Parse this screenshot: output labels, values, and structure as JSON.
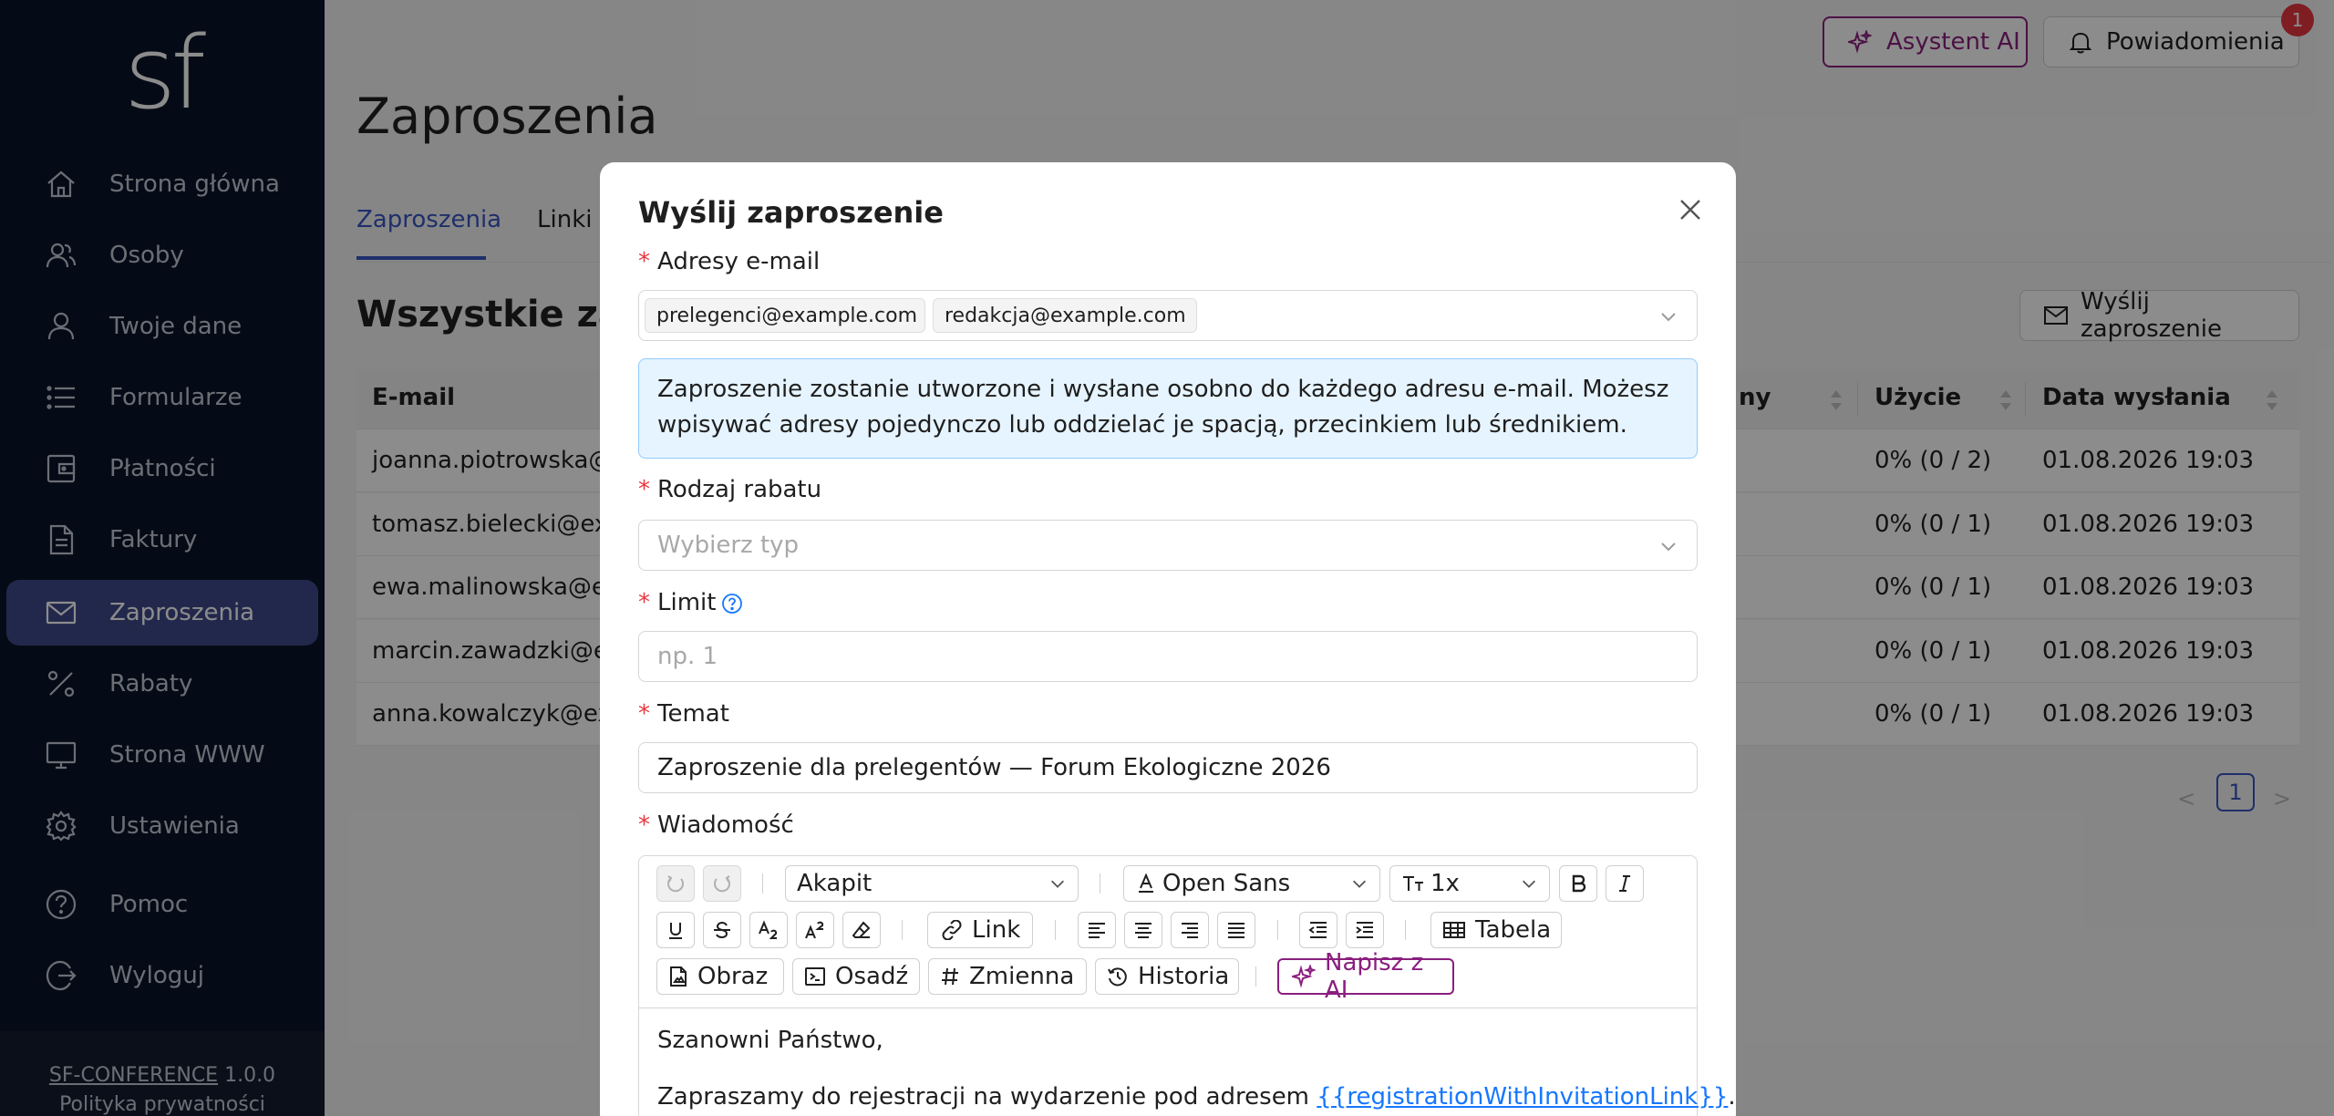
{
  "sidebar": {
    "logo": "sf",
    "items": [
      {
        "label": "Strona główna",
        "icon": "home-icon"
      },
      {
        "label": "Osoby",
        "icon": "users-icon"
      },
      {
        "label": "Twoje dane",
        "icon": "user-icon"
      },
      {
        "label": "Formularze",
        "icon": "list-icon"
      },
      {
        "label": "Płatności",
        "icon": "wallet-icon"
      },
      {
        "label": "Faktury",
        "icon": "document-icon"
      },
      {
        "label": "Zaproszenia",
        "icon": "mail-icon",
        "active": true
      },
      {
        "label": "Rabaty",
        "icon": "percent-icon"
      },
      {
        "label": "Strona WWW",
        "icon": "monitor-icon"
      },
      {
        "label": "Ustawienia",
        "icon": "gear-icon"
      },
      {
        "label": "Pomoc",
        "icon": "question-icon"
      },
      {
        "label": "Wyloguj",
        "icon": "logout-icon"
      }
    ],
    "footer": {
      "app_name": "SF-CONFERENCE",
      "version": "1.0.0",
      "privacy": "Polityka prywatności"
    }
  },
  "header": {
    "ai_button": "Asystent AI",
    "notifications_button": "Powiadomienia",
    "notifications_count": "1"
  },
  "page": {
    "title": "Zaproszenia",
    "tabs": [
      "Zaproszenia",
      "Linki r"
    ],
    "section_title": "Wszystkie zapro",
    "send_button": "Wyślij zaproszenie"
  },
  "table": {
    "columns": [
      "E-mail",
      "ny",
      "Użycie",
      "Data wysłania"
    ],
    "rows": [
      {
        "email": "joanna.piotrowska@e",
        "usage": "0% (0 / 2)",
        "date": "01.08.2026 19:03"
      },
      {
        "email": "tomasz.bielecki@exan",
        "usage": "0% (0 / 1)",
        "date": "01.08.2026 19:03"
      },
      {
        "email": "ewa.malinowska@exa",
        "usage": "0% (0 / 1)",
        "date": "01.08.2026 19:03"
      },
      {
        "email": "marcin.zawadzki@exa",
        "usage": "0% (0 / 1)",
        "date": "01.08.2026 19:03"
      },
      {
        "email": "anna.kowalczyk@exar",
        "usage": "0% (0 / 1)",
        "date": "01.08.2026 19:03"
      }
    ],
    "pagination": {
      "current": "1"
    }
  },
  "modal": {
    "title": "Wyślij zaproszenie",
    "emails_label": "Adresy e-mail",
    "emails": [
      "prelegenci@example.com",
      "redakcja@example.com"
    ],
    "info": "Zaproszenie zostanie utworzone i wysłane osobno do każdego adresu e-mail. Możesz wpisywać adresy pojedynczo lub oddzielać je spacją, przecinkiem lub średnikiem.",
    "discount_label": "Rodzaj rabatu",
    "discount_placeholder": "Wybierz typ",
    "limit_label": "Limit",
    "limit_placeholder": "np. 1",
    "subject_label": "Temat",
    "subject_value": "Zaproszenie dla prelegentów — Forum Ekologiczne 2026",
    "message_label": "Wiadomość",
    "toolbar": {
      "paragraph": "Akapit",
      "font": "Open Sans",
      "size": "1x",
      "link": "Link",
      "table": "Tabela",
      "image": "Obraz",
      "embed": "Osadź",
      "variable": "Zmienna",
      "history": "Historia",
      "ai": "Napisz z AI"
    },
    "body": {
      "greeting": "Szanowni Państwo,",
      "line2_prefix": "Zapraszamy do rejestracji na wydarzenie pod adresem ",
      "line2_variable": "{{registrationWithInvitationLink}}",
      "line2_suffix": "."
    }
  }
}
